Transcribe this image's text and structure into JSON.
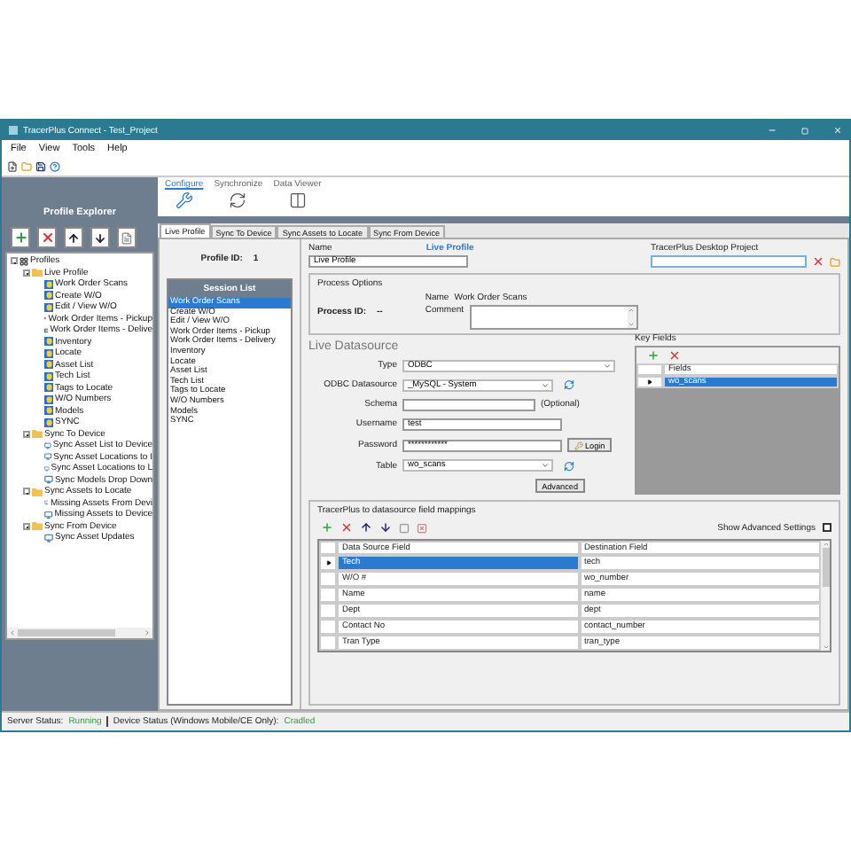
{
  "window": {
    "title": "TracerPlus Connect - Test_Project"
  },
  "menu": [
    "File",
    "View",
    "Tools",
    "Help"
  ],
  "explorer": {
    "title": "Profile Explorer",
    "tree": [
      {
        "label": "Profiles",
        "kind": "root",
        "expanded": true,
        "children": [
          {
            "label": "Live Profile",
            "kind": "folder",
            "expanded": true,
            "children": [
              {
                "label": "Work Order Scans",
                "kind": "session"
              },
              {
                "label": "Create W/O",
                "kind": "session"
              },
              {
                "label": "Edit / View W/O",
                "kind": "session"
              },
              {
                "label": "Work Order Items - Pickup",
                "kind": "session"
              },
              {
                "label": "Work Order Items - Delive",
                "kind": "session"
              },
              {
                "label": "Inventory",
                "kind": "session"
              },
              {
                "label": "Locate",
                "kind": "session"
              },
              {
                "label": "Asset List",
                "kind": "session"
              },
              {
                "label": "Tech List",
                "kind": "session"
              },
              {
                "label": "Tags to Locate",
                "kind": "session"
              },
              {
                "label": "W/O Numbers",
                "kind": "session"
              },
              {
                "label": "Models",
                "kind": "session"
              },
              {
                "label": "SYNC",
                "kind": "session"
              }
            ]
          },
          {
            "label": "Sync To Device",
            "kind": "folder",
            "expanded": true,
            "children": [
              {
                "label": "Sync Asset List to Device",
                "kind": "sync"
              },
              {
                "label": "Sync Asset Locations to I",
                "kind": "sync"
              },
              {
                "label": "Sync Asset Locations to L",
                "kind": "sync"
              },
              {
                "label": "Sync Models Drop Down",
                "kind": "sync"
              }
            ]
          },
          {
            "label": "Sync Assets to Locate",
            "kind": "folder",
            "expanded": true,
            "children": [
              {
                "label": "Missing Assets From Devi",
                "kind": "sync"
              },
              {
                "label": "Missing Assets to Device",
                "kind": "sync"
              }
            ]
          },
          {
            "label": "Sync From Device",
            "kind": "folder",
            "expanded": true,
            "children": [
              {
                "label": "Sync Asset Updates",
                "kind": "sync"
              }
            ]
          }
        ]
      }
    ]
  },
  "ribbon_tabs": [
    {
      "label": "Configure",
      "kind": "wrench",
      "selected": true
    },
    {
      "label": "Synchronize",
      "kind": "sync",
      "selected": false
    },
    {
      "label": "Data Viewer",
      "kind": "viewer",
      "selected": false
    }
  ],
  "profile_tabs": [
    {
      "label": "Live Profile",
      "selected": true
    },
    {
      "label": "Sync To Device",
      "selected": false
    },
    {
      "label": "Sync Assets to Locate",
      "selected": false
    },
    {
      "label": "Sync From Device",
      "selected": false
    }
  ],
  "profile_id": {
    "label": "Profile ID:",
    "value": "1"
  },
  "session_list": {
    "title": "Session List",
    "items": [
      {
        "label": "Work Order Scans",
        "selected": true
      },
      {
        "label": "Create W/O",
        "selected": false
      },
      {
        "label": "Edit / View W/O",
        "selected": false
      },
      {
        "label": "Work Order Items - Pickup",
        "selected": false
      },
      {
        "label": "Work Order Items - Delivery",
        "selected": false
      },
      {
        "label": "Inventory",
        "selected": false
      },
      {
        "label": "Locate",
        "selected": false
      },
      {
        "label": "Asset List",
        "selected": false
      },
      {
        "label": "Tech List",
        "selected": false
      },
      {
        "label": "Tags to Locate",
        "selected": false
      },
      {
        "label": "W/O Numbers",
        "selected": false
      },
      {
        "label": "Models",
        "selected": false
      },
      {
        "label": "SYNC",
        "selected": false
      }
    ]
  },
  "name": {
    "label": "Name",
    "heading": "Live Profile",
    "value": "Live Profile"
  },
  "desktop_project": {
    "label": "TracerPlus Desktop Project"
  },
  "process_options": {
    "title": "Process Options",
    "process_id_label": "Process ID:",
    "process_id_value": "--",
    "name_label": "Name",
    "name_value": "Work Order Scans",
    "comment_label": "Comment"
  },
  "live_datasource": {
    "title": "Live Datasource",
    "fields": [
      {
        "label": "Type",
        "value": "ODBC",
        "kind": "select_wide"
      },
      {
        "label": "ODBC Datasource",
        "value": "_MySQL - System",
        "kind": "select_refresh"
      },
      {
        "label": "Schema",
        "hint": "(Optional)",
        "kind": "text_hint"
      },
      {
        "label": "Username",
        "value": "test",
        "kind": "text"
      },
      {
        "label": "Password",
        "value": "************",
        "button": "Login",
        "kind": "password"
      },
      {
        "label": "Table",
        "value": "wo_scans",
        "kind": "select_refresh"
      }
    ],
    "advanced": "Advanced"
  },
  "key_fields": {
    "title": "Key Fields",
    "column": "Fields",
    "rows": [
      {
        "value": "wo_scans",
        "selected": true
      }
    ]
  },
  "mappings": {
    "title": "TracerPlus to datasource field mappings",
    "show_advanced": {
      "label": "Show Advanced Settings",
      "checked": false
    },
    "columns": [
      "Data Source Field",
      "Destination Field"
    ],
    "rows": [
      {
        "source": "Tech",
        "destination": "tech",
        "selected": true
      },
      {
        "source": "W/O #",
        "destination": "wo_number",
        "selected": false
      },
      {
        "source": "Name",
        "destination": "name",
        "selected": false
      },
      {
        "source": "Dept",
        "destination": "dept",
        "selected": false
      },
      {
        "source": "Contact No",
        "destination": "contact_number",
        "selected": false
      },
      {
        "source": "Tran Type",
        "destination": "tran_type",
        "selected": false
      }
    ]
  },
  "status_bar": {
    "server_label": "Server Status:",
    "server_value": "Running",
    "device_label": "Device Status (Windows Mobile/CE Only):",
    "device_value": "Cradled"
  }
}
